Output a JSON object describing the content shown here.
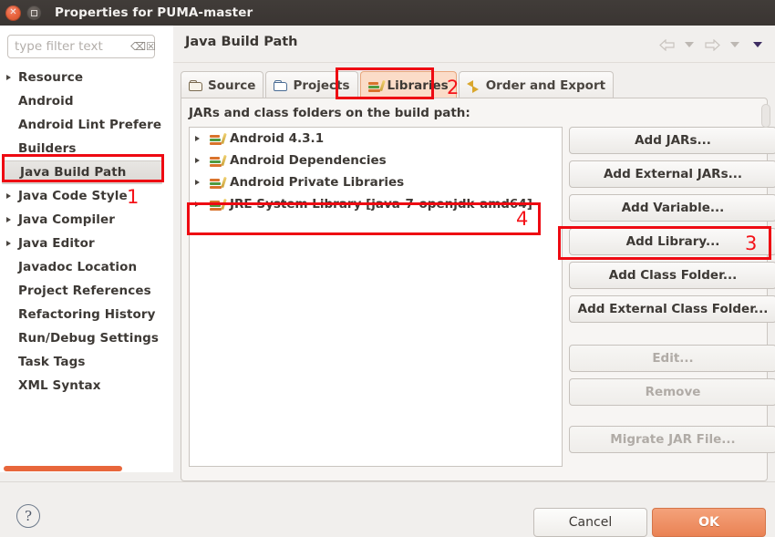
{
  "window": {
    "title": "Properties for PUMA-master",
    "close_icon": "close-icon",
    "maximize_icon": "maximize-icon"
  },
  "sidebar": {
    "filter": {
      "placeholder": "type filter text",
      "value": "",
      "clear_icon": "clear-icon"
    },
    "items": [
      {
        "label": "Resource",
        "expandable": true,
        "selected": false
      },
      {
        "label": "Android",
        "expandable": false,
        "selected": false
      },
      {
        "label": "Android Lint Prefere",
        "expandable": false,
        "selected": false
      },
      {
        "label": "Builders",
        "expandable": false,
        "selected": false
      },
      {
        "label": "Java Build Path",
        "expandable": false,
        "selected": true
      },
      {
        "label": "Java Code Style",
        "expandable": true,
        "selected": false
      },
      {
        "label": "Java Compiler",
        "expandable": true,
        "selected": false
      },
      {
        "label": "Java Editor",
        "expandable": true,
        "selected": false
      },
      {
        "label": "Javadoc Location",
        "expandable": false,
        "selected": false
      },
      {
        "label": "Project References",
        "expandable": false,
        "selected": false
      },
      {
        "label": "Refactoring History",
        "expandable": false,
        "selected": false
      },
      {
        "label": "Run/Debug Settings",
        "expandable": false,
        "selected": false
      },
      {
        "label": "Task Tags",
        "expandable": false,
        "selected": false
      },
      {
        "label": "XML Syntax",
        "expandable": false,
        "selected": false
      }
    ]
  },
  "page": {
    "title": "Java Build Path",
    "nav": {
      "back_icon": "back-arrow-icon",
      "back_menu_icon": "chevron-down-icon",
      "forward_icon": "forward-arrow-icon",
      "forward_menu_icon": "chevron-down-icon",
      "menu_icon": "chevron-down-icon"
    }
  },
  "tabs": [
    {
      "label": "Source",
      "icon": "folder-open-icon",
      "active": false
    },
    {
      "label": "Projects",
      "icon": "folder-blue-icon",
      "active": false
    },
    {
      "label": "Libraries",
      "icon": "books-icon",
      "active": true
    },
    {
      "label": "Order and Export",
      "icon": "order-arrows-icon",
      "active": false
    }
  ],
  "group": {
    "label": "JARs and class folders on the build path:",
    "entries": [
      {
        "label": "Android 4.3.1",
        "icon": "library-icon",
        "expandable": true
      },
      {
        "label": "Android Dependencies",
        "icon": "library-icon",
        "expandable": true
      },
      {
        "label": "Android Private Libraries",
        "icon": "library-icon",
        "expandable": true
      },
      {
        "label": "JRE System Library [java-7-openjdk-amd64]",
        "icon": "library-icon",
        "expandable": true
      }
    ],
    "buttons": [
      {
        "label": "Add JARs...",
        "enabled": true
      },
      {
        "label": "Add External JARs...",
        "enabled": true
      },
      {
        "label": "Add Variable...",
        "enabled": true
      },
      {
        "label": "Add Library...",
        "enabled": true
      },
      {
        "label": "Add Class Folder...",
        "enabled": true
      },
      {
        "label": "Add External Class Folder...",
        "enabled": true
      },
      {
        "label": "Edit...",
        "enabled": false
      },
      {
        "label": "Remove",
        "enabled": false
      },
      {
        "label": "Migrate JAR File...",
        "enabled": false
      }
    ]
  },
  "footer": {
    "help_label": "?",
    "cancel_label": "Cancel",
    "ok_label": "OK"
  },
  "annotations": {
    "step1": "1",
    "step2": "2",
    "step3": "3",
    "step4": "4",
    "color": "#f41218"
  }
}
